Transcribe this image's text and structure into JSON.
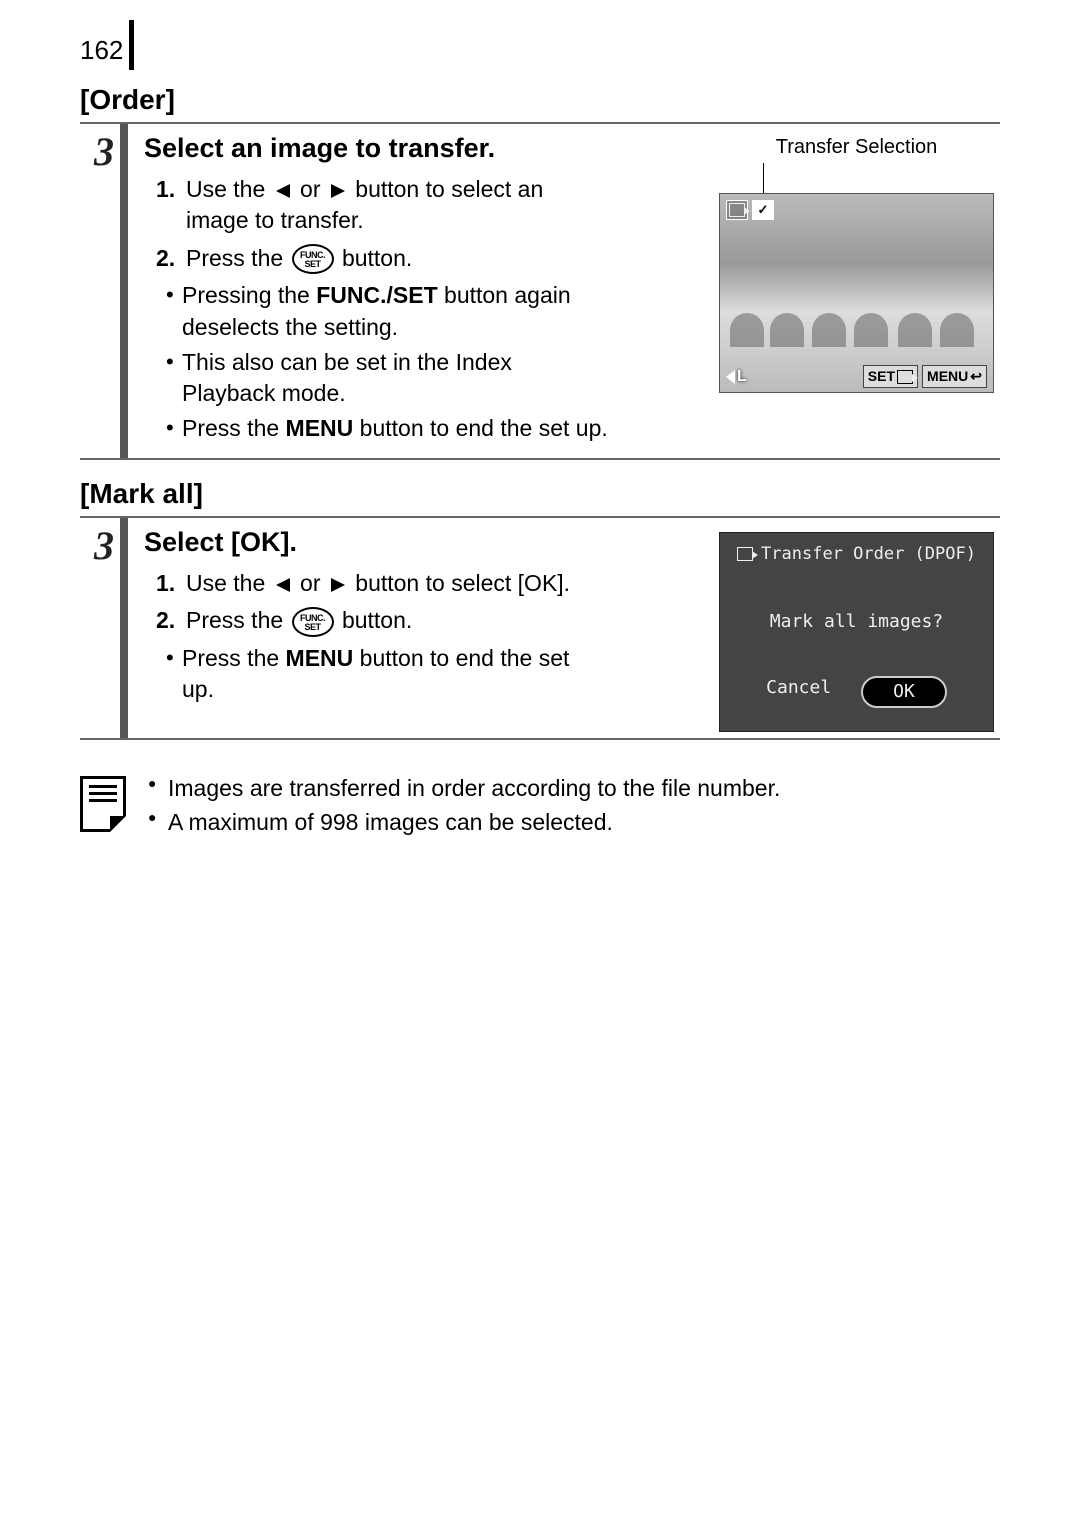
{
  "page_number": "162",
  "order": {
    "label": "[Order]",
    "step_number": "3",
    "title": "Select an image to transfer.",
    "item1_num": "1.",
    "item1_a": "Use the ",
    "item1_b": " or ",
    "item1_c": " button to select an image to transfer.",
    "item2_num": "2.",
    "item2_a": "Press the ",
    "item2_b": " button.",
    "func_top": "FUNC.",
    "func_bot": "SET",
    "bullet1_a": "Pressing the ",
    "bullet1_b": "FUNC./SET",
    "bullet1_c": " button again deselects the setting.",
    "bullet2": "This also can be set in the Index Playback mode.",
    "bullet3_a": "Press the ",
    "bullet3_b": "MENU",
    "bullet3_c": " button to end the set up.",
    "fig_caption": "Transfer Selection",
    "fig_check": "✓",
    "fig_L": "L",
    "fig_set": "SET",
    "fig_menu": "MENU"
  },
  "markall": {
    "label": "[Mark all]",
    "step_number": "3",
    "title": "Select [OK].",
    "item1_num": "1.",
    "item1_a": "Use the ",
    "item1_b": " or ",
    "item1_c": " button to select [OK].",
    "item2_num": "2.",
    "item2_a": "Press the ",
    "item2_b": " button.",
    "func_top": "FUNC.",
    "func_bot": "SET",
    "bullet1_a": "Press the ",
    "bullet1_b": "MENU",
    "bullet1_c": " button to end the set up.",
    "dlg_title": "Transfer Order (DPOF)",
    "dlg_question": "Mark all images?",
    "dlg_cancel": "Cancel",
    "dlg_ok": "OK"
  },
  "notes": {
    "n1": "Images are transferred in order according to the file number.",
    "n2": "A maximum of 998 images can be selected."
  }
}
